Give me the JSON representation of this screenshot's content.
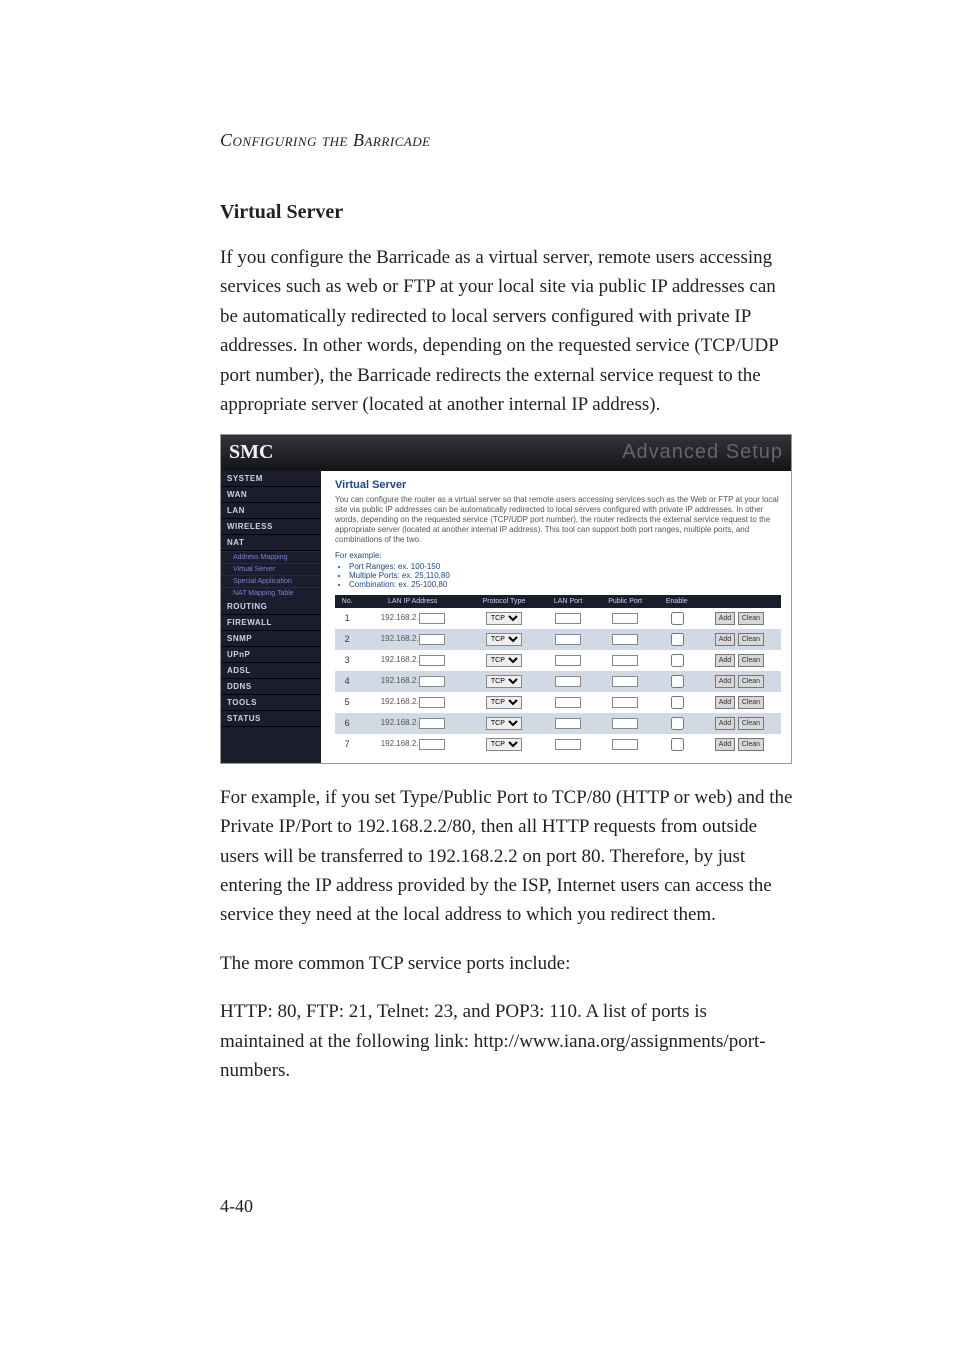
{
  "running_head": "Configuring the Barricade",
  "section_title": "Virtual Server",
  "para1": "If you configure the Barricade as a virtual server, remote users accessing services such as web or FTP at your local site via public IP addresses can be automatically redirected to local servers configured with private IP addresses. In other words, depending on the requested service (TCP/UDP port number), the Barricade redirects the external service request to the appropriate server (located at another internal IP address).",
  "para2": "For example, if you set Type/Public Port to TCP/80 (HTTP or web) and the Private IP/Port to 192.168.2.2/80, then all HTTP requests from outside users will be transferred to 192.168.2.2 on port 80. Therefore, by just entering the IP address provided by the ISP, Internet users can access the service they need at the local address to which you redirect them.",
  "para3": "The more common TCP service ports include:",
  "para4": "HTTP: 80, FTP: 21, Telnet: 23, and POP3: 110. A list of ports is maintained at the following link: http://www.iana.org/assignments/port-numbers.",
  "page_number": "4-40",
  "screenshot": {
    "logo": "SMC",
    "adv": "Advanced Setup",
    "sidebar": {
      "items": [
        "SYSTEM",
        "WAN",
        "LAN",
        "WIRELESS",
        "NAT",
        "ROUTING",
        "FIREWALL",
        "SNMP",
        "UPnP",
        "ADSL",
        "DDNS",
        "TOOLS",
        "STATUS"
      ],
      "subs": [
        "Address Mapping",
        "Virtual Server",
        "Special Application",
        "NAT Mapping Table"
      ]
    },
    "main": {
      "heading": "Virtual Server",
      "desc": "You can configure the router as a virtual server so that remote users accessing services such as the Web or FTP at your local site via public IP addresses can be automatically redirected to local servers configured with private IP addresses. In other words, depending on the requested service (TCP/UDP port number), the router redirects the external service request to the appropriate server (located at another internal IP address). This tool can support both port ranges, multiple ports, and combinations of the two.",
      "example_label": "For example:",
      "bullets": [
        "Port Ranges: ex. 100-150",
        "Multiple Ports: ex. 25,110,80",
        "Combination: ex. 25-100,80"
      ],
      "columns": [
        "No.",
        "LAN IP Address",
        "Protocol Type",
        "LAN Port",
        "Public Port",
        "Enable"
      ],
      "ip_prefix": "192.168.2.",
      "protocol": "TCP",
      "btn_add": "Add",
      "btn_clean": "Clean",
      "row_count": 7
    }
  }
}
